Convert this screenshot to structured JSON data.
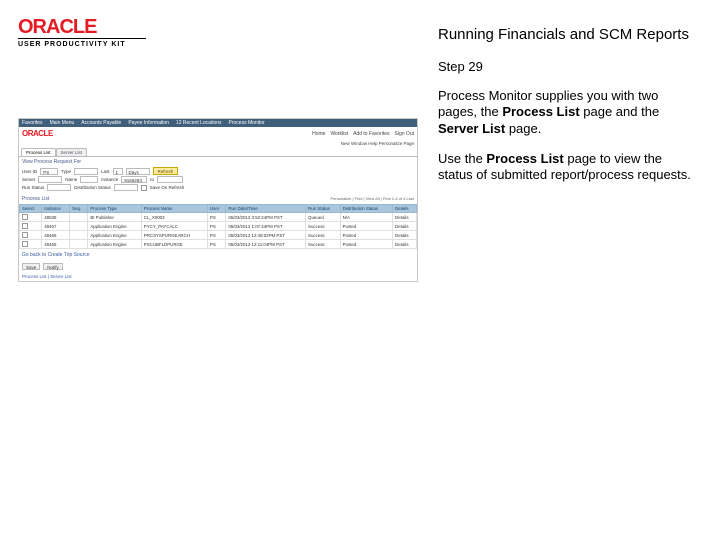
{
  "header": {
    "logo_main": "ORACLE",
    "logo_sub": "USER PRODUCTIVITY KIT",
    "doc_title": "Running Financials and SCM Reports"
  },
  "step": {
    "label": "Step 29"
  },
  "desc": {
    "p1_a": "Process Monitor supplies you with two pages, the ",
    "p1_b": "Process List",
    "p1_c": " page and the ",
    "p1_d": "Server List",
    "p1_e": " page.",
    "p2_a": "Use the ",
    "p2_b": "Process List",
    "p2_c": " page to view the status of submitted report/process requests."
  },
  "shot": {
    "menu": [
      "Favorites",
      "Main Menu",
      "Accounts Payable",
      "Payee Information",
      "12 Recent Locations",
      "Process Monitor"
    ],
    "banner_logo": "ORACLE",
    "banner_nav": [
      "Home",
      "Worklist",
      "Add to Favorites",
      "Sign Out"
    ],
    "top_right": "New Window   Help   Personalize Page",
    "tabs": {
      "active": "Process List",
      "other": "Server List"
    },
    "section_title": "View Process Request For",
    "filters": {
      "user_lbl": "User ID",
      "user_val": "PS",
      "type_lbl": "Type",
      "type_val": "",
      "last_lbl": "Last",
      "last_val": "1",
      "unit_val": "Days",
      "refresh": "Refresh",
      "server_lbl": "Server",
      "server_val": "",
      "name_lbl": "Name",
      "name_val": "",
      "instance_lbl": "Instance",
      "instance_val": "9166283",
      "to_lbl": "to",
      "run_lbl": "Run Status",
      "run_val": "",
      "dist_lbl": "Distribution Status",
      "dist_val": "",
      "save_chk": "Save On Refresh"
    },
    "list_title": "Process List",
    "list_range": "Personalize | Find | View All |   First 1-4 of 4 Last",
    "cols": [
      "Select",
      "Instance",
      "Seq.",
      "Process Type",
      "Process Name",
      "User",
      "Run Date/Time",
      "Run Status",
      "Distribution Status",
      "Details"
    ],
    "rows": [
      {
        "inst": "48536",
        "seq": "",
        "ptype": "BI Publisher",
        "pname": "CL_X0003",
        "user": "PS",
        "dt": "06/03/2013 3:52:24PM PST",
        "rstat": "Queued",
        "dstat": "N/A",
        "det": "Details"
      },
      {
        "inst": "48467",
        "seq": "",
        "ptype": "Application Engine",
        "pname": "PYCY_PAYCALC",
        "user": "PS",
        "dt": "06/03/2013 1:07:44PM PST",
        "rstat": "Success",
        "dstat": "Posted",
        "det": "Details"
      },
      {
        "inst": "48466",
        "seq": "",
        "ptype": "Application Engine",
        "pname": "PRCSYSPURGEARCH",
        "user": "PS",
        "dt": "06/03/2013 12:48:02PM PST",
        "rstat": "Success",
        "dstat": "Posted",
        "det": "Details"
      },
      {
        "inst": "48465",
        "seq": "",
        "ptype": "Application Engine",
        "pname": "PSCUBFLDPURGE",
        "user": "PS",
        "dt": "06/03/2013 12:11:04PM PST",
        "rstat": "Success",
        "dstat": "Posted",
        "det": "Details"
      }
    ],
    "go_back": "Go back to Create Trip Source",
    "footer_btns": [
      "Save",
      "Notify"
    ],
    "bottom_tabs": "Process List | Server List"
  }
}
